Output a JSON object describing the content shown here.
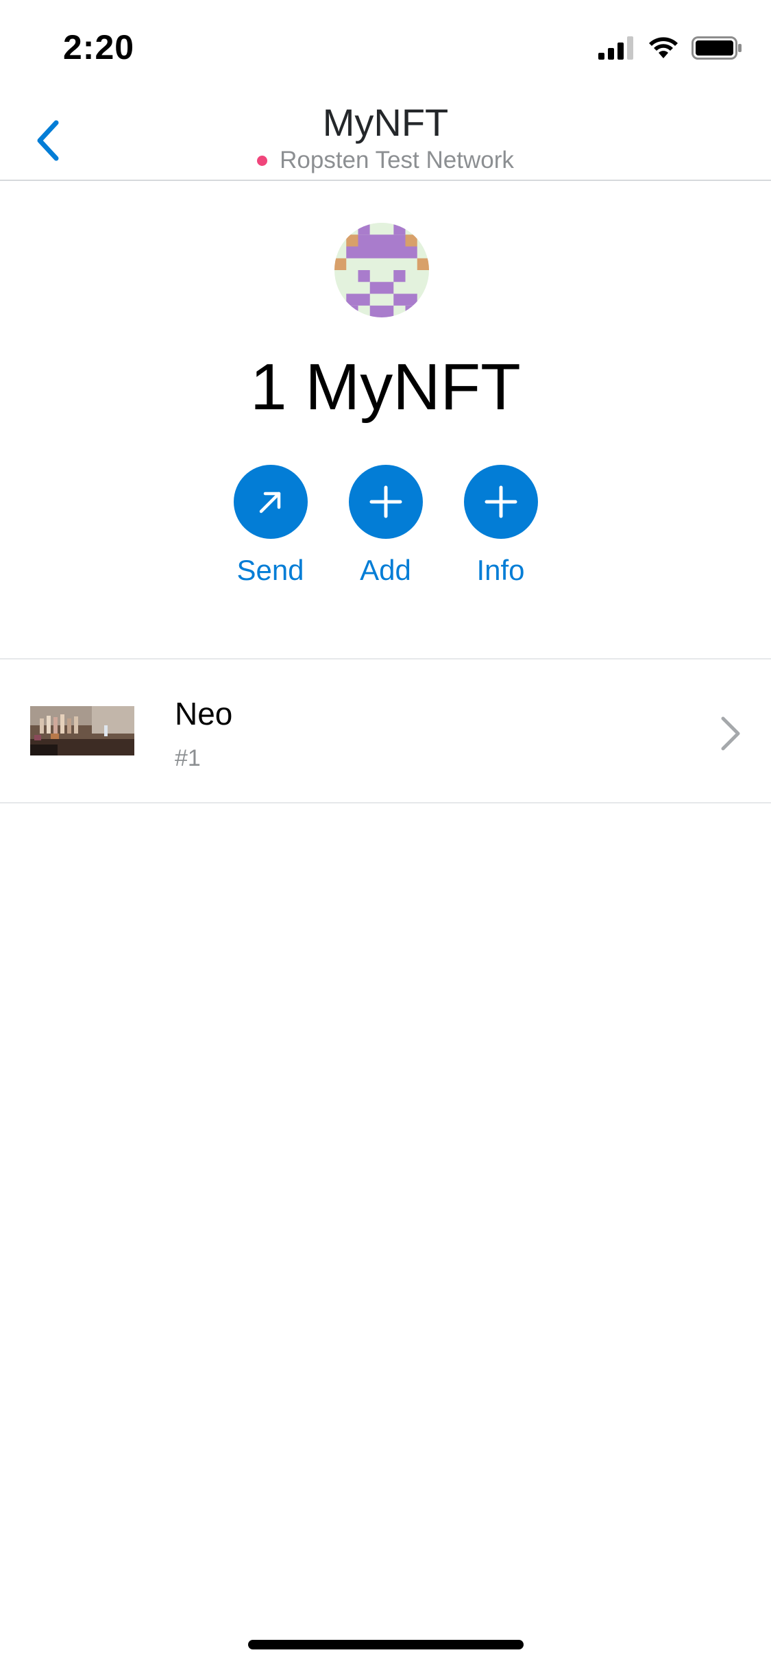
{
  "status_bar": {
    "time": "2:20",
    "icons": [
      "cellular-signal-icon",
      "wifi-icon",
      "battery-icon"
    ]
  },
  "header": {
    "title": "MyNFT",
    "network": "Ropsten Test Network",
    "network_dot_color": "#f0457b",
    "back_icon": "chevron-left-icon"
  },
  "token": {
    "avatar": "identicon-avatar",
    "balance": "1 MyNFT"
  },
  "actions": [
    {
      "label": "Send",
      "icon": "arrow-up-right-icon"
    },
    {
      "label": "Add",
      "icon": "plus-icon"
    },
    {
      "label": "Info",
      "icon": "plus-icon"
    }
  ],
  "collectibles": [
    {
      "name": "Neo",
      "id": "#1",
      "thumbnail": "nft-thumbnail-image"
    }
  ],
  "colors": {
    "accent": "#037dd6",
    "text_primary": "#24272a",
    "text_secondary": "#8c8f92",
    "divider": "#e6e8ea"
  }
}
